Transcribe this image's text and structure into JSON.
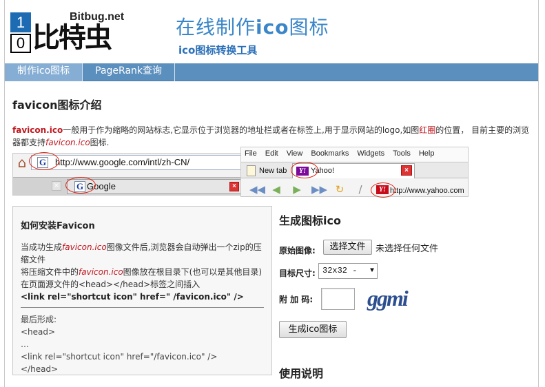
{
  "header": {
    "logo_digit_top": "1",
    "logo_digit_bottom": "0",
    "logo_brand_en": "Bitbug.net",
    "logo_brand_cn": "比特虫",
    "title_prefix": "在线制作",
    "title_bold": "ico",
    "title_suffix": "图标",
    "subtitle": "ico图标转换工具"
  },
  "nav": {
    "items": [
      {
        "label": "制作ico图标",
        "active": true
      },
      {
        "label": "PageRank查询",
        "active": false
      }
    ]
  },
  "intro": {
    "heading": "favicon图标介绍",
    "lead": "favicon.ico",
    "text_1": "一般用于作为缩略的网站标志,它显示位于浏览器的地址栏或者在标签上,用于显示网站的logo,如图",
    "red_circle": "红圈",
    "text_2": "的位置， 目前主要的浏览器都支持",
    "italic": "favicon.ico",
    "text_3": "图标."
  },
  "illustration_chrome": {
    "url": "http://www.google.com/intl/zh-CN/",
    "tab_label": "Google",
    "g_icon": "G"
  },
  "illustration_firefox": {
    "menu": [
      "File",
      "Edit",
      "View",
      "Bookmarks",
      "Widgets",
      "Tools",
      "Help"
    ],
    "tab_new": "New tab",
    "tab_yahoo": "Yahoo!",
    "yahoo_icon": "Y!",
    "url": "http://www.yahoo.com"
  },
  "install": {
    "heading": "如何安装Favicon",
    "p1_a": "当成功生成",
    "p1_it": "favicon.ico",
    "p1_b": "图像文件后,浏览器会自动弹出一个zip的压缩文件",
    "p2_a": "将压缩文件中的",
    "p2_it": "favicon.ico",
    "p2_b": "图像放在根目录下(也可以是其他目录)",
    "p3": "在页面源文件的<head></head>标签之间插入",
    "code": "<link rel=\"shortcut icon\" href=\" /favicon.ico\" />",
    "final_label": "最后形成:",
    "final_1": "<head>",
    "final_2": "…",
    "final_3": "<link rel=\"shortcut icon\" href=\"/favicon.ico\" />",
    "final_4": "</head>"
  },
  "generator": {
    "title": "生成图标ico",
    "source_label": "原始图像:",
    "file_button": "选择文件",
    "file_status": "未选择任何文件",
    "size_label": "目标尺寸:",
    "size_value": "32x32 -",
    "code_label": "附 加 码:",
    "captcha_text": "ggmi",
    "submit_button": "生成ico图标",
    "usage_title": "使用说明"
  },
  "colors": {
    "nav_bg": "#5b8fbe",
    "nav_active": "#86aed4",
    "title_blue": "#3a86c8",
    "accent_red": "#c0171e",
    "logo_blue": "#1d6bb3"
  }
}
